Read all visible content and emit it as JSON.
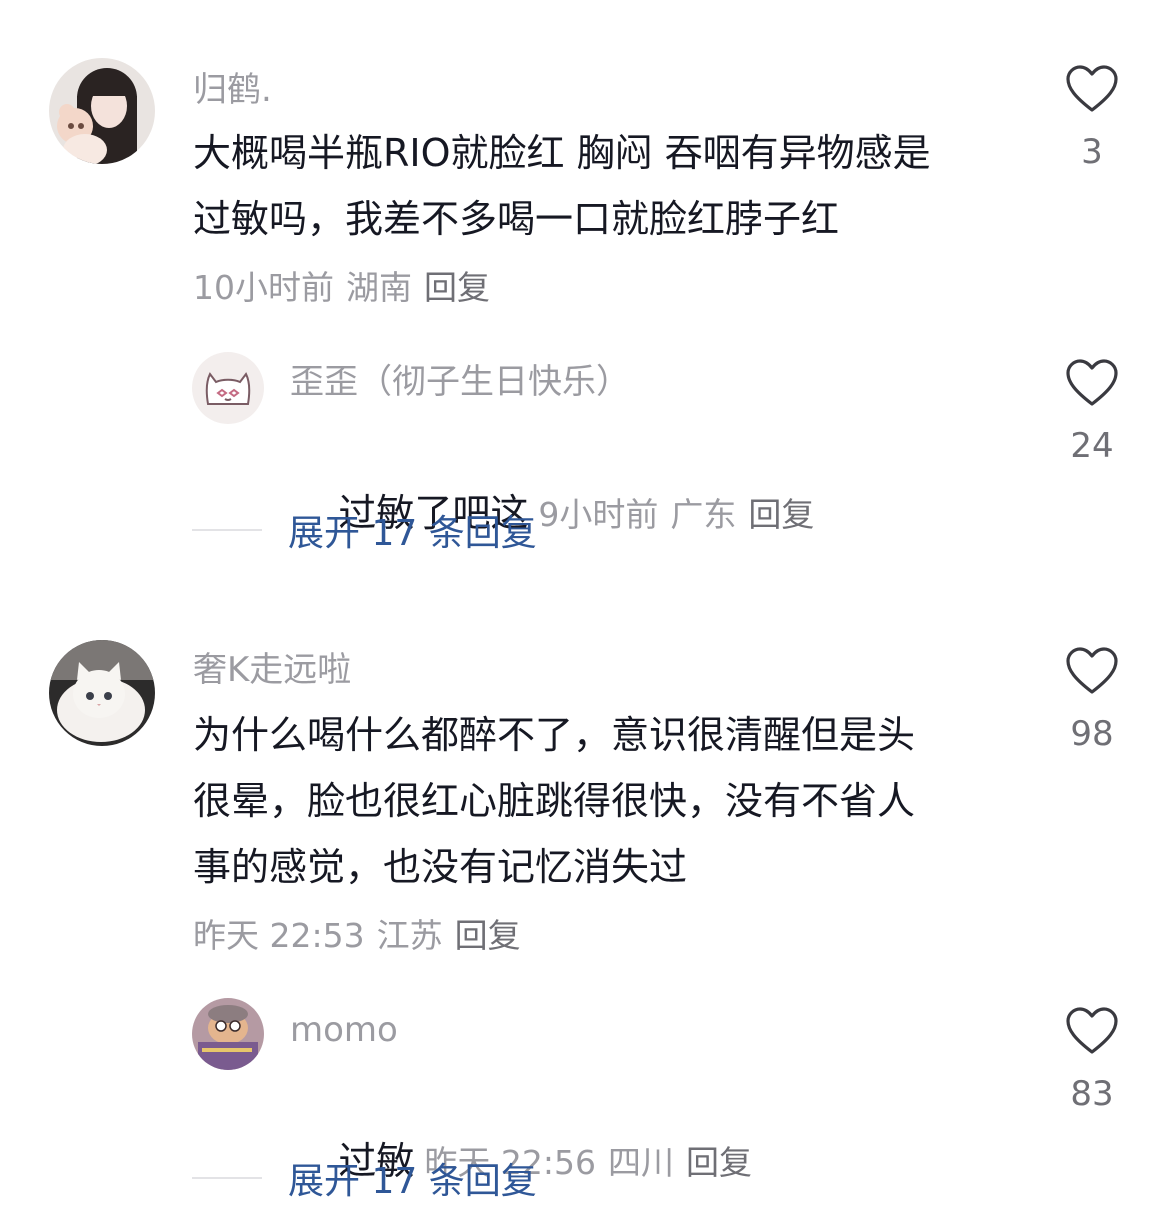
{
  "comments": [
    {
      "username": "归鹤.",
      "text_lines": [
        "大概喝半瓶RIO就脸红 胸闷 吞咽有异物感是",
        "过敏吗，我差不多喝一口就脸红脖子红"
      ],
      "time": "10小时前",
      "location": "湖南",
      "reply_label": "回复",
      "likes": "3",
      "reply": {
        "username": "歪歪（彻子生日快乐）",
        "text": "过敏了吧这",
        "time": "9小时前",
        "location": "广东",
        "reply_label": "回复",
        "likes": "24"
      },
      "expand_label": "展开 17 条回复"
    },
    {
      "username": "奢K走远啦",
      "text_lines": [
        "为什么喝什么都醉不了，意识很清醒但是头",
        "很晕，脸也很红心脏跳得很快，没有不省人",
        "事的感觉，也没有记忆消失过"
      ],
      "time": "昨天 22:53",
      "location": "江苏",
      "reply_label": "回复",
      "likes": "98",
      "reply": {
        "username": "momo",
        "text": "过敏",
        "time": "昨天 22:56",
        "location": "四川",
        "reply_label": "回复",
        "likes": "83"
      },
      "expand_label": "展开 17 条回复"
    }
  ],
  "icons": {
    "like": "heart-outline-icon"
  },
  "colors": {
    "username": "#9b9ba1",
    "body_text": "#161823",
    "expand_link": "#2f5797"
  }
}
